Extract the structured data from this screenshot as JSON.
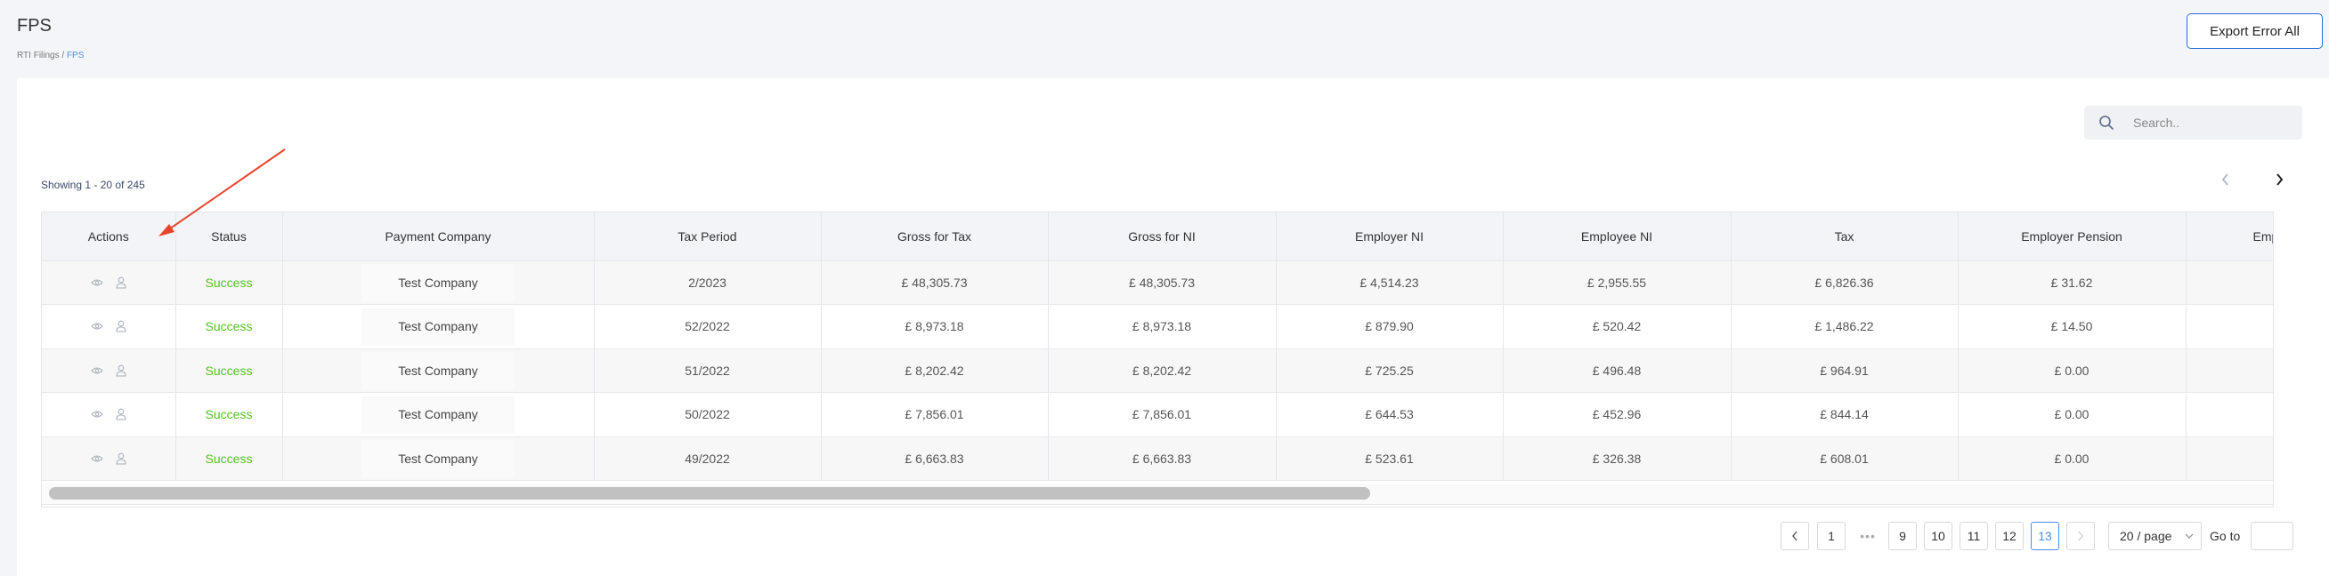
{
  "header": {
    "title": "FPS",
    "breadcrumb": {
      "parent": "RTI Filings",
      "separator": " / ",
      "current": "FPS"
    },
    "export_label": "Export Error All"
  },
  "search": {
    "placeholder": "Search.."
  },
  "showing": "Showing 1 - 20 of 245",
  "table": {
    "columns": [
      "Actions",
      "Status",
      "Payment Company",
      "Tax Period",
      "Gross for Tax",
      "Gross for NI",
      "Employer NI",
      "Employee NI",
      "Tax",
      "Employer Pension",
      "Employee"
    ],
    "rows": [
      {
        "status": "Success",
        "company": "Test Company",
        "period": "2/2023",
        "gross_tax": "£ 48,305.73",
        "gross_ni": "£ 48,305.73",
        "employer_ni": "£ 4,514.23",
        "employee_ni": "£ 2,955.55",
        "tax": "£ 6,826.36",
        "employer_pension": "£ 31.62"
      },
      {
        "status": "Success",
        "company": "Test Company",
        "period": "52/2022",
        "gross_tax": "£ 8,973.18",
        "gross_ni": "£ 8,973.18",
        "employer_ni": "£ 879.90",
        "employee_ni": "£ 520.42",
        "tax": "£ 1,486.22",
        "employer_pension": "£ 14.50"
      },
      {
        "status": "Success",
        "company": "Test Company",
        "period": "51/2022",
        "gross_tax": "£ 8,202.42",
        "gross_ni": "£ 8,202.42",
        "employer_ni": "£ 725.25",
        "employee_ni": "£ 496.48",
        "tax": "£ 964.91",
        "employer_pension": "£ 0.00"
      },
      {
        "status": "Success",
        "company": "Test Company",
        "period": "50/2022",
        "gross_tax": "£ 7,856.01",
        "gross_ni": "£ 7,856.01",
        "employer_ni": "£ 644.53",
        "employee_ni": "£ 452.96",
        "tax": "£ 844.14",
        "employer_pension": "£ 0.00"
      },
      {
        "status": "Success",
        "company": "Test Company",
        "period": "49/2022",
        "gross_tax": "£ 6,663.83",
        "gross_ni": "£ 6,663.83",
        "employer_ni": "£ 523.61",
        "employee_ni": "£ 326.38",
        "tax": "£ 608.01",
        "employer_pension": "£ 0.00"
      }
    ]
  },
  "pagination": {
    "pages": [
      "1",
      "9",
      "10",
      "11",
      "12",
      "13"
    ],
    "active_page": "13",
    "ellipsis": "•••",
    "page_size": "20 / page",
    "goto_label": "Go to"
  },
  "colors": {
    "accent": "#4a90e2",
    "success": "#52c41a",
    "annotation_arrow": "#e8452c"
  }
}
